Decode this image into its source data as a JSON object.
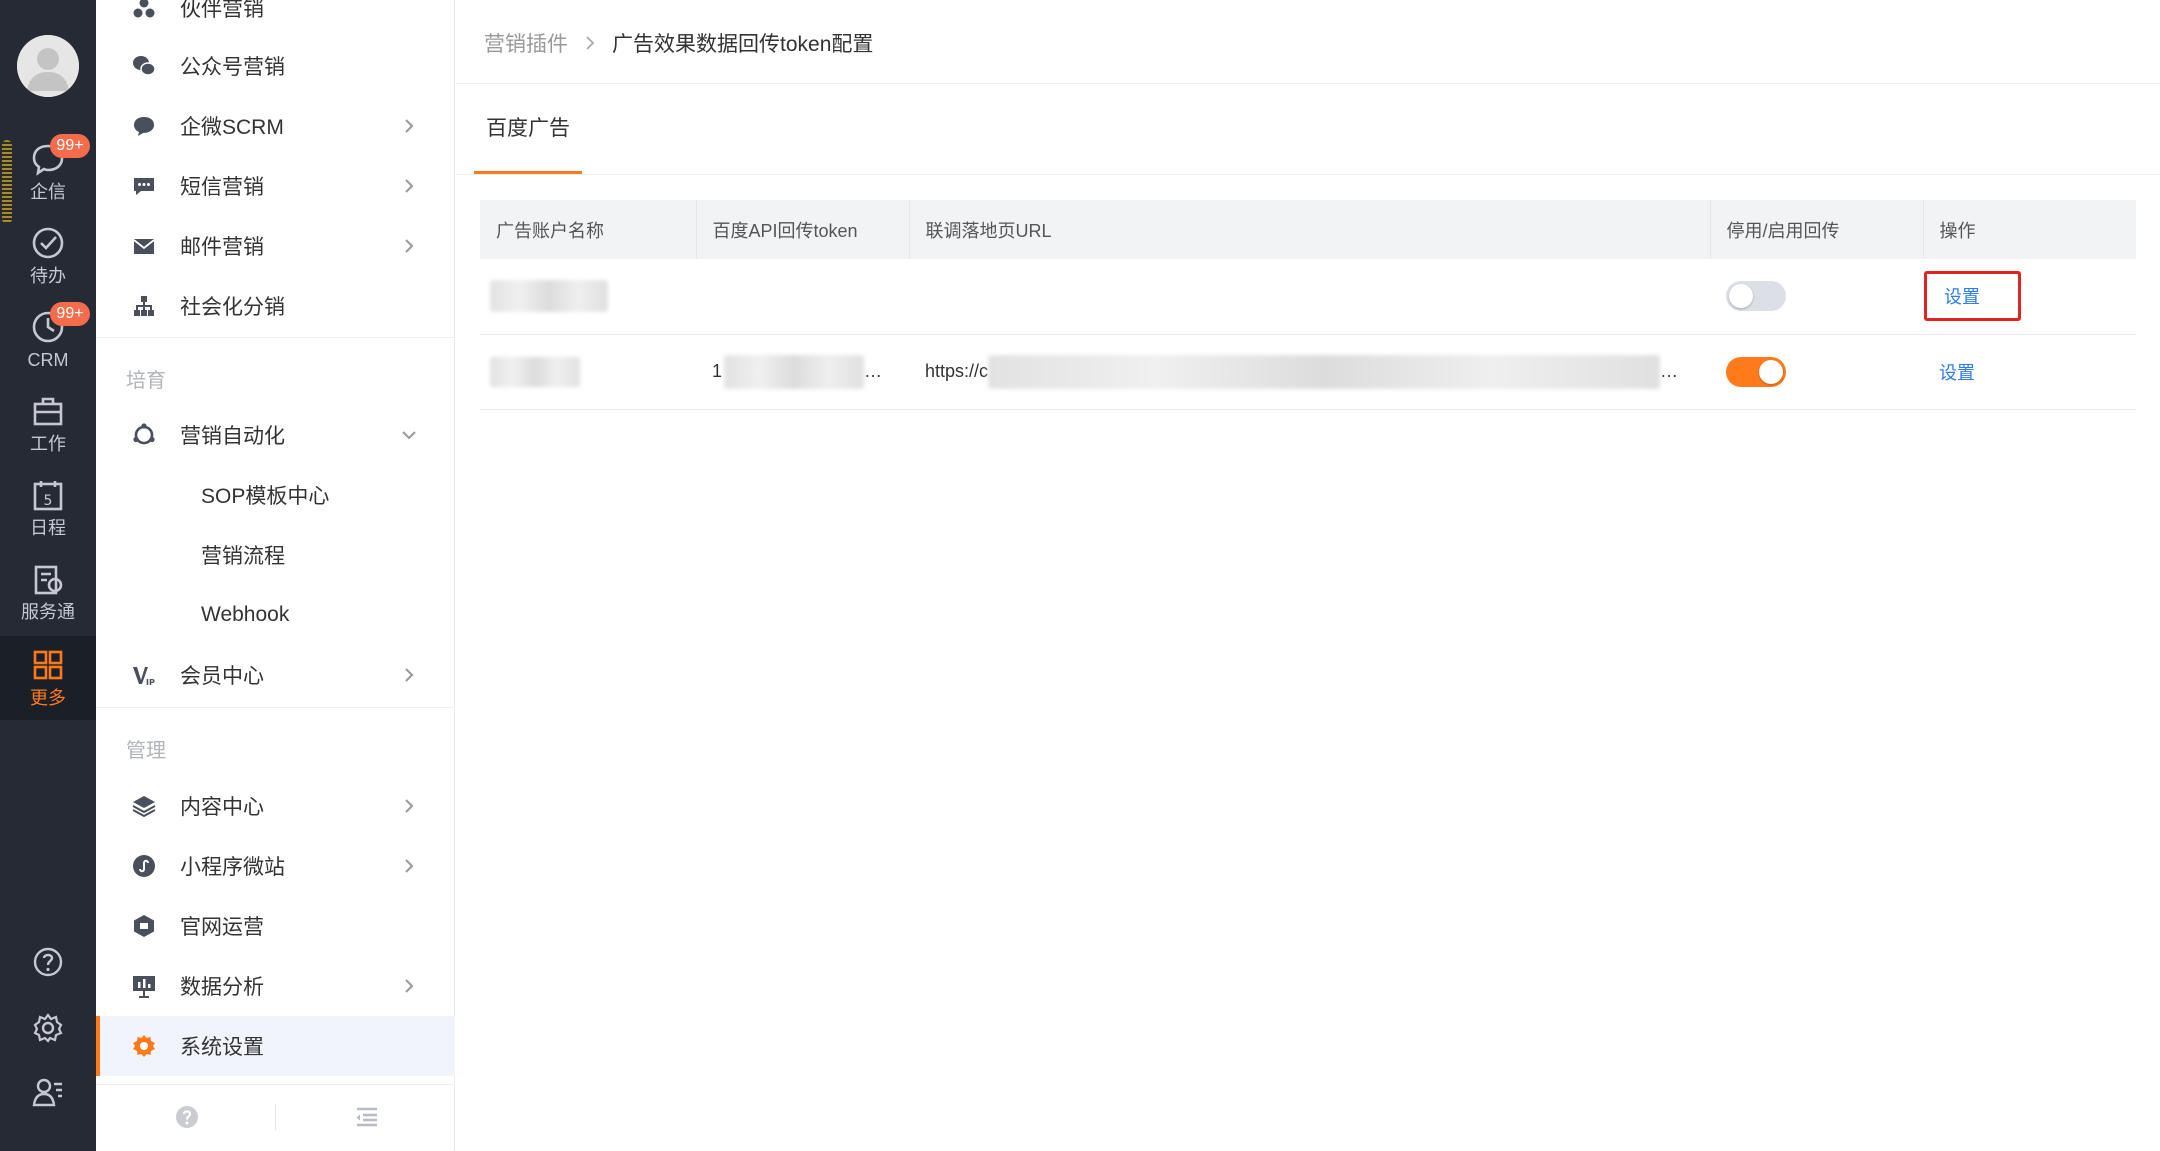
{
  "rail": {
    "items": [
      {
        "label": "企信",
        "badge": "99+"
      },
      {
        "label": "待办"
      },
      {
        "label": "CRM",
        "badge": "99+"
      },
      {
        "label": "工作"
      },
      {
        "label": "日程"
      },
      {
        "label": "服务通"
      },
      {
        "label": "更多"
      }
    ]
  },
  "menu": {
    "items_top": [
      {
        "label": "伙伴营销"
      },
      {
        "label": "公众号营销"
      },
      {
        "label": "企微SCRM"
      },
      {
        "label": "短信营销"
      },
      {
        "label": "邮件营销"
      },
      {
        "label": "社会化分销"
      }
    ],
    "group_cultivate": "培育",
    "automation": "营销自动化",
    "sub_items": [
      {
        "label": "SOP模板中心"
      },
      {
        "label": "营销流程"
      },
      {
        "label": "Webhook"
      }
    ],
    "member_center": "会员中心",
    "group_manage": "管理",
    "items_manage": [
      {
        "label": "内容中心"
      },
      {
        "label": "小程序微站"
      },
      {
        "label": "官网运营"
      },
      {
        "label": "数据分析"
      },
      {
        "label": "系统设置"
      }
    ]
  },
  "breadcrumb": {
    "parent": "营销插件",
    "current": "广告效果数据回传token配置"
  },
  "tabs": [
    {
      "label": "百度广告"
    }
  ],
  "table": {
    "columns": [
      "广告账户名称",
      "百度API回传token",
      "联调落地页URL",
      "停用/启用回传",
      "操作"
    ],
    "rows": [
      {
        "token": "",
        "url": "",
        "enabled": false,
        "action": "设置"
      },
      {
        "token": "1",
        "token_tail": "…",
        "url": "https://c",
        "url_tail": "…",
        "enabled": true,
        "action": "设置"
      }
    ]
  },
  "colors": {
    "accent": "#ff7a1a",
    "link": "#2d7cf6",
    "highlight": "#e32222",
    "rail": "#252a35"
  }
}
